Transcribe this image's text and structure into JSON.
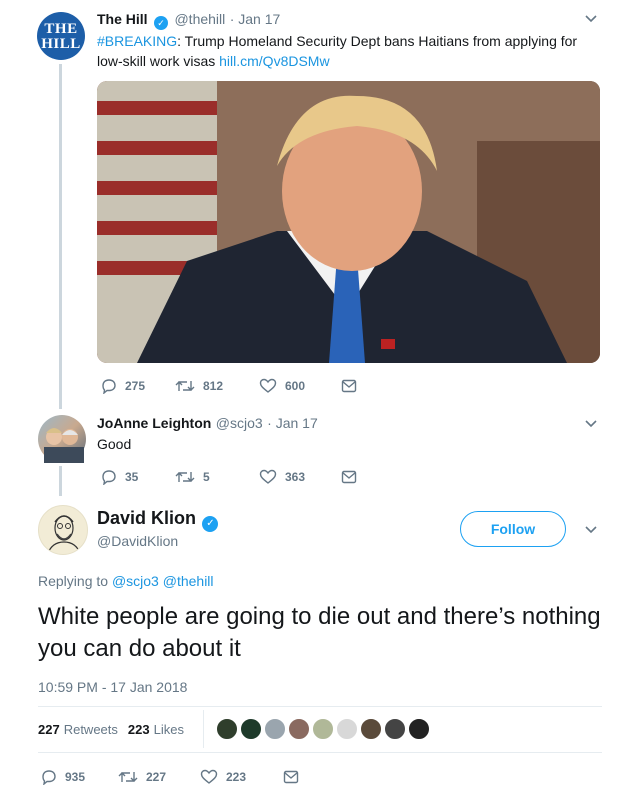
{
  "tweet1": {
    "avatar_text": "THE HILL",
    "name": "The Hill",
    "handle": "@thehill",
    "time": "· Jan 17",
    "hashtag": "#BREAKING",
    "text_rest": ": Trump Homeland Security Dept bans Haitians from applying for low-skill work visas ",
    "link": "hill.cm/Qv8DSMw",
    "replies": "275",
    "retweets": "812",
    "likes": "600"
  },
  "reply": {
    "name": "JoAnne Leighton",
    "handle": "@scjo3",
    "time": "· Jan 17",
    "text": "Good",
    "replies": "35",
    "retweets": "5",
    "likes": "363"
  },
  "main": {
    "name": "David Klion",
    "handle": "@DavidKlion",
    "follow_label": "Follow",
    "replying_prefix": "Replying to ",
    "replying_to_1": "@scjo3",
    "replying_to_2": "@thehill",
    "text": "White people are going to die out and there’s nothing you can do about it",
    "timestamp": "10:59 PM - 17 Jan 2018",
    "retweet_count": "227",
    "retweet_label": "Retweets",
    "like_count": "223",
    "like_label": "Likes",
    "replies": "935",
    "retweets": "227",
    "likes": "223"
  },
  "colors": {
    "accent": "#1da1f2",
    "link": "#1b95e0",
    "muted": "#657786",
    "thread": "#ccd6dd"
  },
  "icons": [
    "verified-badge-icon",
    "chevron-down-icon",
    "reply-icon",
    "retweet-icon",
    "like-icon",
    "dm-icon"
  ]
}
